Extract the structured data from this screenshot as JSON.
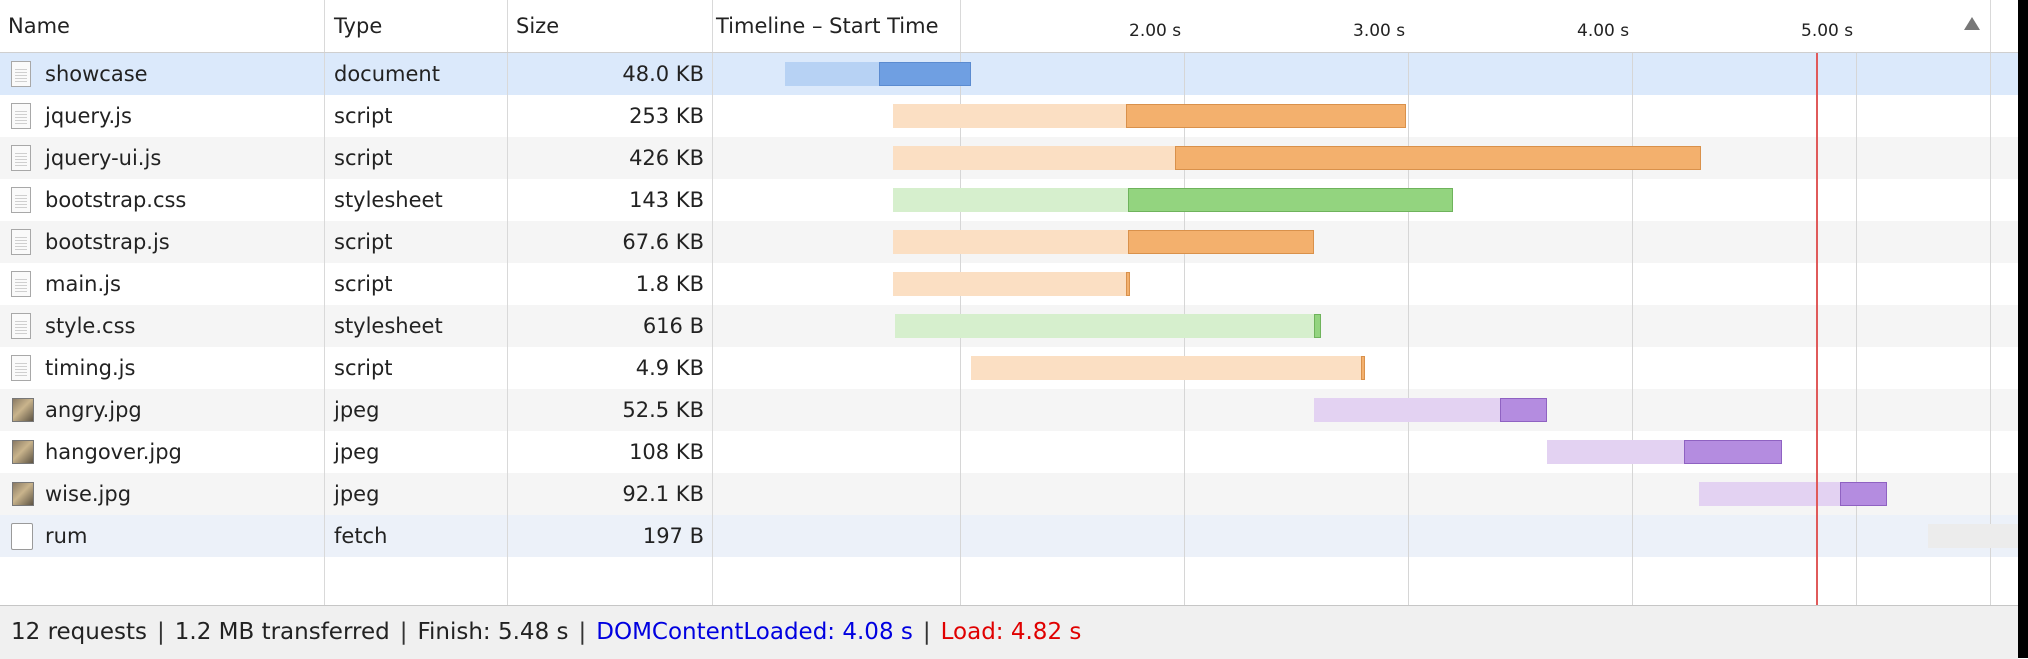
{
  "columns": {
    "name": "Name",
    "type": "Type",
    "size": "Size",
    "timeline": "Timeline – Start Time"
  },
  "timeline_ticks": [
    "2.00 s",
    "3.00 s",
    "4.00 s",
    "5.00 s"
  ],
  "requests": [
    {
      "name": "showcase",
      "type": "document",
      "size": "48.0 KB",
      "icon": "document-icon",
      "color": "blue",
      "waiting_start": 0.22,
      "receive_start": 0.64,
      "end": 1.05
    },
    {
      "name": "jquery.js",
      "type": "script",
      "size": "253 KB",
      "icon": "document-icon",
      "color": "orange",
      "waiting_start": 0.7,
      "receive_start": 1.74,
      "end": 2.99
    },
    {
      "name": "jquery-ui.js",
      "type": "script",
      "size": "426 KB",
      "icon": "document-icon",
      "color": "orange",
      "waiting_start": 0.7,
      "receive_start": 1.96,
      "end": 4.31
    },
    {
      "name": "bootstrap.css",
      "type": "stylesheet",
      "size": "143 KB",
      "icon": "document-icon",
      "color": "green",
      "waiting_start": 0.7,
      "receive_start": 1.75,
      "end": 3.2
    },
    {
      "name": "bootstrap.js",
      "type": "script",
      "size": "67.6 KB",
      "icon": "document-icon",
      "color": "orange",
      "waiting_start": 0.7,
      "receive_start": 1.75,
      "end": 2.58
    },
    {
      "name": "main.js",
      "type": "script",
      "size": "1.8 KB",
      "icon": "document-icon",
      "color": "orange",
      "waiting_start": 0.7,
      "receive_start": 1.74,
      "end": 1.76
    },
    {
      "name": "style.css",
      "type": "stylesheet",
      "size": "616 B",
      "icon": "document-icon",
      "color": "green",
      "waiting_start": 0.71,
      "receive_start": 2.58,
      "end": 2.61
    },
    {
      "name": "timing.js",
      "type": "script",
      "size": "4.9 KB",
      "icon": "document-icon",
      "color": "orange",
      "waiting_start": 1.05,
      "receive_start": 2.79,
      "end": 2.81
    },
    {
      "name": "angry.jpg",
      "type": "jpeg",
      "size": "52.5 KB",
      "icon": "image-icon",
      "color": "purple",
      "waiting_start": 2.58,
      "receive_start": 3.41,
      "end": 3.62
    },
    {
      "name": "hangover.jpg",
      "type": "jpeg",
      "size": "108 KB",
      "icon": "image-icon",
      "color": "purple",
      "waiting_start": 3.62,
      "receive_start": 4.23,
      "end": 4.67
    },
    {
      "name": "wise.jpg",
      "type": "jpeg",
      "size": "92.1 KB",
      "icon": "image-icon",
      "color": "purple",
      "waiting_start": 4.3,
      "receive_start": 4.93,
      "end": 5.14
    },
    {
      "name": "rum",
      "type": "fetch",
      "size": "197 B",
      "icon": "blank-icon",
      "color": "gray",
      "waiting_start": 5.32,
      "receive_start": 5.74,
      "end": 5.76
    }
  ],
  "load_marker_seconds": 4.82,
  "selected_row": 0,
  "colors": {
    "blue": {
      "light": "#b7d2f4",
      "dark": "#6f9fe2",
      "border": "#5b8bd0"
    },
    "orange": {
      "light": "#fbdfc3",
      "dark": "#f3b06d",
      "border": "#d9914b"
    },
    "green": {
      "light": "#d6efcd",
      "dark": "#93d47f",
      "border": "#6fb35c"
    },
    "purple": {
      "light": "#e3d2f2",
      "dark": "#b48ce0",
      "border": "#8f62c2"
    },
    "gray": {
      "light": "#ececec",
      "dark": "#d8d8d8",
      "border": "#c0c0c0"
    },
    "selected_row": "#dbe9fb",
    "alt_row": "#f5f5f5",
    "dom_content_loaded": "#0000e0",
    "load": "#e00000"
  },
  "status": {
    "requests": "12 requests",
    "transferred": "1.2 MB transferred",
    "finish": "Finish: 5.48 s",
    "dom_content_loaded": "DOMContentLoaded: 4.08 s",
    "load": "Load: 4.82 s",
    "separator": "|"
  }
}
